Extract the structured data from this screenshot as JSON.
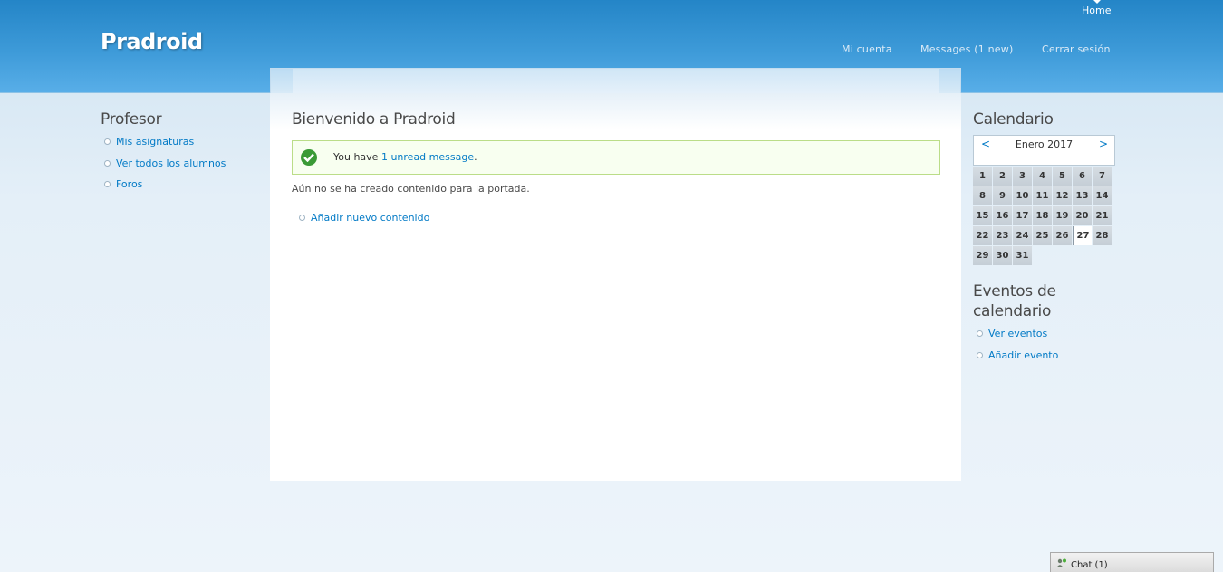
{
  "header": {
    "site_name": "Pradroid",
    "primary_links": [
      {
        "label": "Home"
      }
    ],
    "secondary_links": [
      {
        "label": "Mi cuenta"
      },
      {
        "label": "Messages (1 new)"
      },
      {
        "label": "Cerrar sesión"
      }
    ]
  },
  "sidebar_left": {
    "title": "Profesor",
    "items": [
      {
        "label": "Mis asignaturas"
      },
      {
        "label": "Ver todos los alumnos"
      },
      {
        "label": "Foros"
      }
    ]
  },
  "main": {
    "title": "Bienvenido a Pradroid",
    "status": {
      "prefix": "You have ",
      "link": "1 unread message",
      "suffix": "."
    },
    "no_content": "Aún no se ha creado contenido para la portada.",
    "add_content": "Añadir nuevo contenido"
  },
  "sidebar_right": {
    "calendar_title": "Calendario",
    "calendar": {
      "prev": "<",
      "next": ">",
      "month": "Enero 2017",
      "days": [
        "1",
        "2",
        "3",
        "4",
        "5",
        "6",
        "7",
        "8",
        "9",
        "10",
        "11",
        "12",
        "13",
        "14",
        "15",
        "16",
        "17",
        "18",
        "19",
        "20",
        "21",
        "22",
        "23",
        "24",
        "25",
        "26",
        "27",
        "28",
        "29",
        "30",
        "31"
      ],
      "today": "27"
    },
    "events_title": "Eventos de calendario",
    "events_items": [
      {
        "label": "Ver eventos"
      },
      {
        "label": "Añadir evento"
      }
    ]
  },
  "chat": {
    "label": "Chat (1)"
  }
}
